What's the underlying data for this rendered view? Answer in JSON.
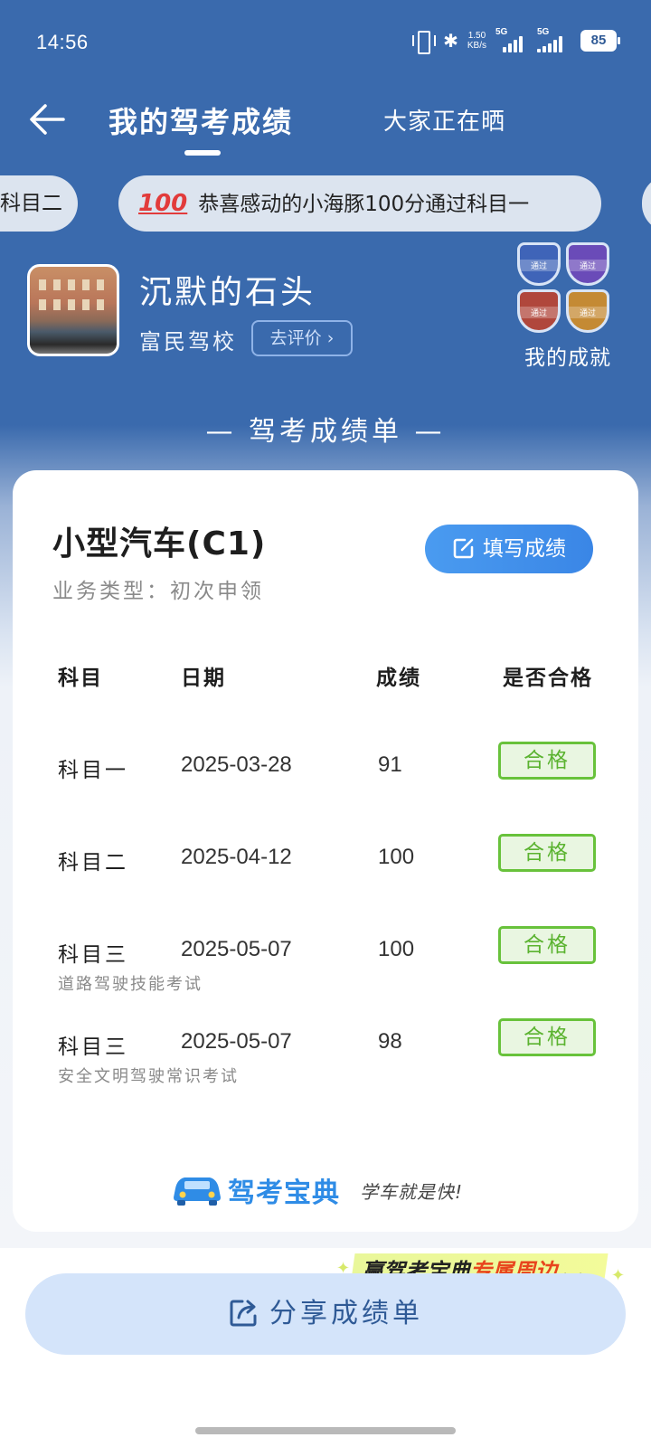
{
  "status_bar": {
    "time": "14:56",
    "net_speed_value": "1.50",
    "net_speed_unit": "KB/s",
    "sim1": "5G",
    "sim2": "5G",
    "battery": "85"
  },
  "nav": {
    "back_icon": "back-arrow-icon",
    "tab_active": "我的驾考成绩",
    "tab_other": "大家正在晒"
  },
  "ticker": {
    "prev_text": "科目二",
    "main_emoji": "100",
    "main_text": "恭喜感动的小海豚100分通过科目一"
  },
  "profile": {
    "username": "沉默的石头",
    "school": "富民驾校",
    "review_button": "去评价",
    "achievements_label": "我的成就",
    "badges": [
      "通过",
      "通过",
      "通过",
      "通过"
    ]
  },
  "sheet_title": "— 驾考成绩单 —",
  "card": {
    "vehicle_type": "小型汽车(C1)",
    "business_type": "业务类型：初次申领",
    "fill_button": "填写成绩",
    "headers": {
      "subject": "科目",
      "date": "日期",
      "score": "成绩",
      "passed": "是否合格"
    },
    "rows": [
      {
        "subject": "科目一",
        "note": "",
        "date": "2025-03-28",
        "score": "91",
        "passed": "合格"
      },
      {
        "subject": "科目二",
        "note": "",
        "date": "2025-04-12",
        "score": "100",
        "passed": "合格"
      },
      {
        "subject": "科目三",
        "note": "道路驾驶技能考试",
        "date": "2025-05-07",
        "score": "100",
        "passed": "合格"
      },
      {
        "subject": "科目三",
        "note": "安全文明驾驶常识考试",
        "date": "2025-05-07",
        "score": "98",
        "passed": "合格"
      }
    ],
    "brand_name": "驾考宝典",
    "brand_slogan": "学车就是快!"
  },
  "promo": {
    "text_a": "赢驾考宝典",
    "text_b": "专属周边"
  },
  "share_button": "分享成绩单",
  "colors": {
    "header_blue": "#3a6aad",
    "accent_blue": "#3a86e6",
    "pass_green": "#68c23b",
    "promo_red": "#e8451d"
  }
}
